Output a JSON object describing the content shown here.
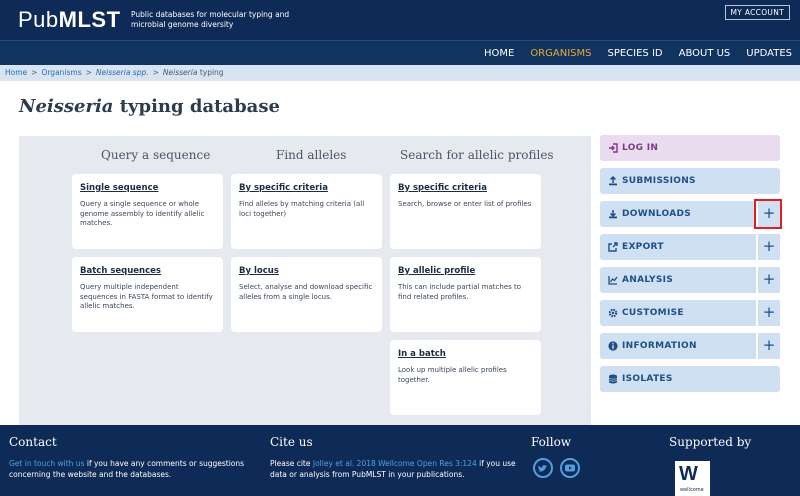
{
  "header": {
    "logo_pub": "Pub",
    "logo_mlst": "MLST",
    "tagline": "Public databases for molecular typing and microbial genome diversity",
    "account_label": "MY ACCOUNT"
  },
  "nav": [
    {
      "label": "HOME",
      "active": false
    },
    {
      "label": "ORGANISMS",
      "active": true
    },
    {
      "label": "SPECIES ID",
      "active": false
    },
    {
      "label": "ABOUT US",
      "active": false
    },
    {
      "label": "UPDATES",
      "active": false
    }
  ],
  "breadcrumb": {
    "home": "Home",
    "organisms": "Organisms",
    "genus": "Neisseria spp.",
    "current_italic": "Neisseria",
    "current_rest": " typing"
  },
  "page_title": {
    "italic": "Neisseria",
    "rest": " typing database"
  },
  "columns": [
    {
      "heading": "Query a sequence",
      "cards": [
        {
          "title": "Single sequence",
          "text": "Query a single sequence or whole genome assembly to identify allelic matches."
        },
        {
          "title": "Batch sequences",
          "text": "Query multiple independent sequences in FASTA format to identify allelic matches."
        }
      ]
    },
    {
      "heading": "Find alleles",
      "cards": [
        {
          "title": "By specific criteria",
          "text": "Find alleles by matching criteria (all loci together)"
        },
        {
          "title": "By locus",
          "text": "Select, analyse and download specific alleles from a single locus."
        }
      ]
    },
    {
      "heading": "Search for allelic profiles",
      "cards": [
        {
          "title": "By specific criteria",
          "text": "Search, browse or enter list of profiles"
        },
        {
          "title": "By allelic profile",
          "text": "This can include partial matches to find related profiles."
        },
        {
          "title": "In a batch",
          "text": "Look up multiple allelic profiles together."
        }
      ]
    }
  ],
  "sidebar": [
    {
      "label": "LOG IN",
      "icon": "login-icon",
      "plus": false
    },
    {
      "label": "SUBMISSIONS",
      "icon": "upload-icon",
      "plus": false
    },
    {
      "label": "DOWNLOADS",
      "icon": "download-icon",
      "plus": true,
      "highlight": true
    },
    {
      "label": "EXPORT",
      "icon": "export-icon",
      "plus": true
    },
    {
      "label": "ANALYSIS",
      "icon": "chart-icon",
      "plus": true
    },
    {
      "label": "CUSTOMISE",
      "icon": "gear-icon",
      "plus": true
    },
    {
      "label": "INFORMATION",
      "icon": "info-icon",
      "plus": true
    },
    {
      "label": "ISOLATES",
      "icon": "database-icon",
      "plus": false
    }
  ],
  "plus_symbol": "+",
  "footer": {
    "contact_heading": "Contact",
    "contact_link": "Get in touch with us",
    "contact_text": " if you have any comments or suggestions concerning the website and the databases.",
    "cite_heading": "Cite us",
    "cite_pre": "Please cite ",
    "cite_link": "Jolley et al. 2018 Wellcome Open Res 3:124",
    "cite_post": " if you use data or analysis from PubMLST in your publications.",
    "follow_heading": "Follow",
    "supported_heading": "Supported by",
    "wellcome_letter": "W",
    "wellcome_label": "wellcome"
  },
  "colors": {
    "header_bg": "#0e2b57",
    "nav_active": "#f0a830",
    "sidebar_bg": "#cfe0f2",
    "login_bg": "#eadcef",
    "highlight": "#e02020"
  }
}
